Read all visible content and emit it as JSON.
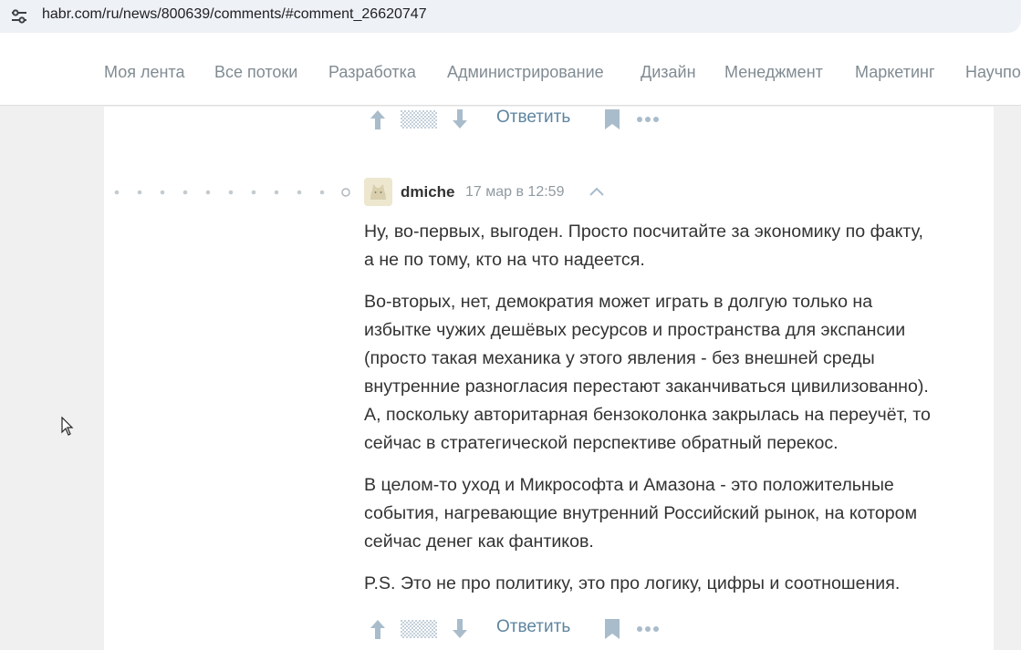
{
  "browser": {
    "url": "habr.com/ru/news/800639/comments/#comment_26620747"
  },
  "nav": {
    "items": [
      "Моя лента",
      "Все потоки",
      "Разработка",
      "Администрирование",
      "Дизайн",
      "Менеджмент",
      "Маркетинг",
      "Научпо"
    ]
  },
  "comment_previous": {
    "reply_label": "Ответить"
  },
  "comment": {
    "author": "dmiche",
    "time": "17 мар в 12:59",
    "paragraphs": [
      [
        "Ну, во-первых, выгоден. Просто посчитайте за экономику по факту,",
        "а не по тому, кто на что надеется."
      ],
      [
        "Во-вторых, нет, демократия может играть в долгую только на",
        "избытке чужих дешёвых ресурсов и пространства для экспансии",
        "(просто такая механика у этого явления - без внешней среды",
        "внутренние разногласия перестают заканчиваться цивилизованно).",
        "А, поскольку авторитарная бензоколонка закрылась на переучёт, то",
        "сейчас в стратегической перспективе обратный перекос."
      ],
      [
        "В целом-то уход и Микрософта и Амазона - это положительные",
        "события, нагревающие внутренний Российский рынок, на котором",
        "сейчас денег как фантиков."
      ],
      [
        "P.S. Это не про политику, это про логику, цифры и соотношения."
      ]
    ],
    "reply_label": "Ответить"
  },
  "colors": {
    "nav_text": "#808b92",
    "link": "#5e85a0",
    "icon": "#a9bccb",
    "body_text": "#333333"
  }
}
